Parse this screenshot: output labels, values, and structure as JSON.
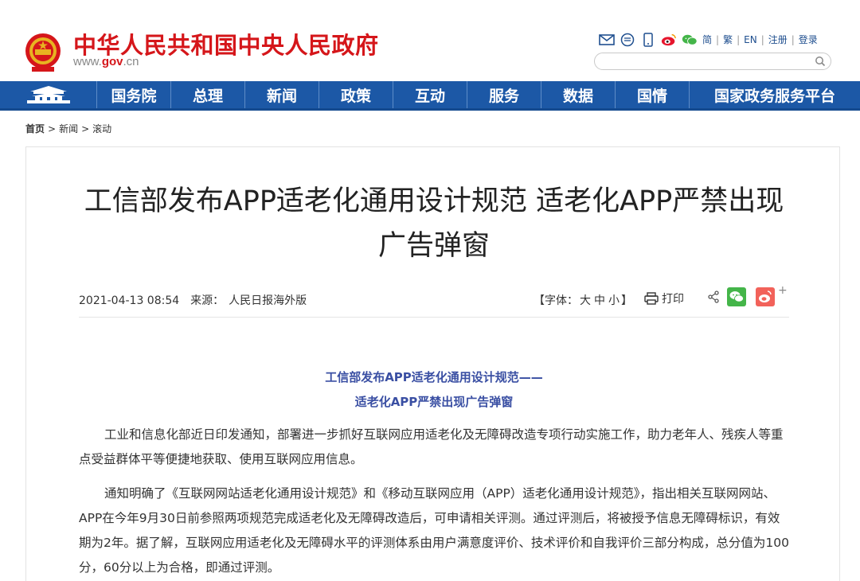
{
  "header": {
    "site_title": "中华人民共和国中央人民政府",
    "url_prefix": "www.",
    "url_domain": "gov",
    "url_suffix": ".cn",
    "tools": [
      "mail-icon",
      "rss-icon",
      "mobile-icon",
      "weibo-icon",
      "wechat-icon"
    ],
    "lang_links": [
      "简",
      "繁",
      "EN",
      "注册",
      "登录"
    ],
    "search_placeholder": ""
  },
  "nav": {
    "items": [
      "国务院",
      "总理",
      "新闻",
      "政策",
      "互动",
      "服务",
      "数据",
      "国情",
      "国家政务服务平台"
    ]
  },
  "breadcrumb": {
    "home": "首页",
    "items": [
      "新闻",
      "滚动"
    ],
    "separator": ">"
  },
  "article": {
    "title": "工信部发布APP适老化通用设计规范 适老化APP严禁出现广告弹窗",
    "date": "2021-04-13 08:54",
    "source_label": "来源：",
    "source": "人民日报海外版",
    "font_label_open": "【字体：",
    "font_large": "大",
    "font_medium": "中",
    "font_small": "小",
    "font_label_close": "】",
    "print_label": "打印",
    "lead_line1": "工信部发布APP适老化通用设计规范——",
    "lead_line2": "适老化APP严禁出现广告弹窗",
    "paragraph1": "工业和信息化部近日印发通知，部署进一步抓好互联网应用适老化及无障碍改造专项行动实施工作，助力老年人、残疾人等重点受益群体平等便捷地获取、使用互联网应用信息。",
    "paragraph2": "通知明确了《互联网网站适老化通用设计规范》和《移动互联网应用（APP）适老化通用设计规范》，指出相关互联网网站、APP在今年9月30日前参照两项规范完成适老化及无障碍改造后，可申请相关评测。通过评测后，将被授予信息无障碍标识，有效期为2年。据了解，互联网应用适老化及无障碍水平的评测体系由用户满意度评价、技术评价和自我评价三部分构成，总分值为100分，60分以上为合格，即通过评测。"
  },
  "colors": {
    "brand_red": "#d5161a",
    "nav_blue": "#1c58a6",
    "lead_blue": "#3a4fa3"
  }
}
